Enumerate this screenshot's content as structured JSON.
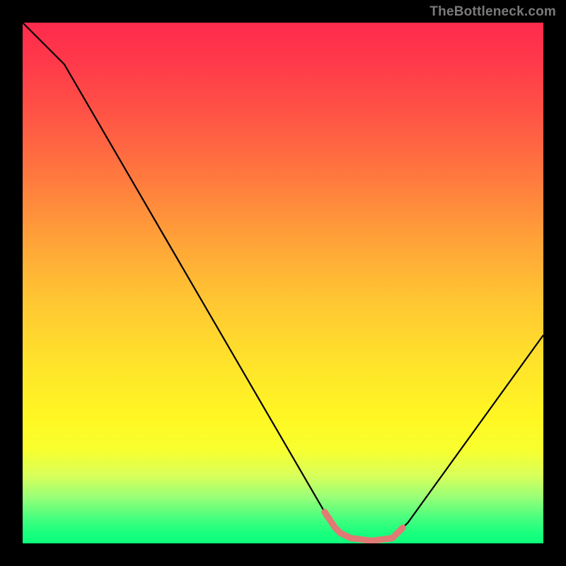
{
  "attribution": "TheBottleneck.com",
  "chart_data": {
    "type": "line",
    "title": "",
    "xlabel": "",
    "ylabel": "",
    "xlim": [
      0,
      100
    ],
    "ylim": [
      0,
      100
    ],
    "series": [
      {
        "name": "curve",
        "x": [
          0,
          8,
          58,
          60,
          61,
          63,
          67,
          71,
          72,
          73,
          74,
          100
        ],
        "y": [
          100,
          92,
          6,
          3,
          2,
          1,
          0.5,
          1,
          2,
          3,
          4,
          40
        ]
      },
      {
        "name": "highlight",
        "x": [
          58,
          60,
          61,
          63,
          67,
          71,
          72,
          73
        ],
        "y": [
          6,
          3,
          2,
          1,
          0.5,
          1,
          2,
          3
        ]
      }
    ],
    "colors": {
      "curve": "#000000",
      "highlight": "#e07a74"
    }
  }
}
